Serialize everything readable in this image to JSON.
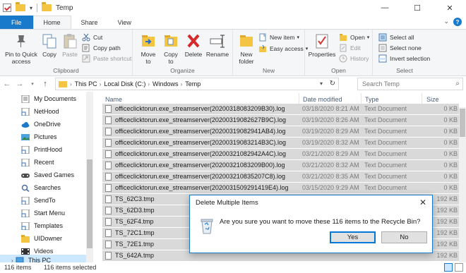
{
  "window": {
    "title": "Temp"
  },
  "tabs": [
    "File",
    "Home",
    "Share",
    "View"
  ],
  "ribbon": {
    "clipboard": {
      "label": "Clipboard",
      "pin": "Pin to Quick access",
      "copy": "Copy",
      "paste": "Paste",
      "cut": "Cut",
      "copy_path": "Copy path",
      "paste_shortcut": "Paste shortcut"
    },
    "organize": {
      "label": "Organize",
      "move_to": "Move to",
      "copy_to": "Copy to",
      "delete": "Delete",
      "rename": "Rename"
    },
    "new": {
      "label": "New",
      "new_folder": "New folder",
      "new_item": "New item",
      "easy_access": "Easy access"
    },
    "open": {
      "label": "Open",
      "properties": "Properties",
      "open": "Open",
      "edit": "Edit",
      "history": "History"
    },
    "select": {
      "label": "Select",
      "select_all": "Select all",
      "select_none": "Select none",
      "invert": "Invert selection"
    }
  },
  "address": {
    "crumbs": [
      "This PC",
      "Local Disk (C:)",
      "Windows",
      "Temp"
    ],
    "search_placeholder": "Search Temp"
  },
  "nav": [
    "My Documents",
    "NetHood",
    "OneDrive",
    "Pictures",
    "PrintHood",
    "Recent",
    "Saved Games",
    "Searches",
    "SendTo",
    "Start Menu",
    "Templates",
    "UIDowner",
    "Videos",
    "This PC"
  ],
  "columns": {
    "name": "Name",
    "date": "Date modified",
    "type": "Type",
    "size": "Size"
  },
  "files": [
    {
      "name": "officeclicktorun.exe_streamserver(20200318083209B30).log",
      "date": "03/18/2020 8:21 AM",
      "type": "Text Document",
      "size": "0 KB"
    },
    {
      "name": "officeclicktorun.exe_streamserver(20200319082627B9C).log",
      "date": "03/19/2020 8:26 AM",
      "type": "Text Document",
      "size": "0 KB"
    },
    {
      "name": "officeclicktorun.exe_streamserver(20200319082941AB4).log",
      "date": "03/19/2020 8:29 AM",
      "type": "Text Document",
      "size": "0 KB"
    },
    {
      "name": "officeclicktorun.exe_streamserver(20200319083214B3C).log",
      "date": "03/19/2020 8:32 AM",
      "type": "Text Document",
      "size": "0 KB"
    },
    {
      "name": "officeclicktorun.exe_streamserver(20200321082942A4C).log",
      "date": "03/21/2020 8:29 AM",
      "type": "Text Document",
      "size": "0 KB"
    },
    {
      "name": "officeclicktorun.exe_streamserver(20200321083209B00).log",
      "date": "03/21/2020 8:32 AM",
      "type": "Text Document",
      "size": "0 KB"
    },
    {
      "name": "officeclicktorun.exe_streamserver(202003210835207C8).log",
      "date": "03/21/2020 8:35 AM",
      "type": "Text Document",
      "size": "0 KB"
    },
    {
      "name": "officeclicktorun.exe_streamserver(2020031509291419E4).log",
      "date": "03/15/2020 9:29 AM",
      "type": "Text Document",
      "size": "0 KB"
    },
    {
      "name": "TS_62C3.tmp",
      "date": "",
      "type": "TMP File",
      "size": "192 KB"
    },
    {
      "name": "TS_62D3.tmp",
      "date": "",
      "type": "",
      "size": "192 KB"
    },
    {
      "name": "TS_62F4.tmp",
      "date": "",
      "type": "",
      "size": "192 KB"
    },
    {
      "name": "TS_72C1.tmp",
      "date": "",
      "type": "",
      "size": "192 KB"
    },
    {
      "name": "TS_72E1.tmp",
      "date": "",
      "type": "",
      "size": "192 KB"
    },
    {
      "name": "TS_642A.tmp",
      "date": "",
      "type": "",
      "size": "192 KB"
    }
  ],
  "status": {
    "count": "116 items",
    "selected": "116 items selected"
  },
  "dialog": {
    "title": "Delete Multiple Items",
    "message": "Are you sure you want to move these 116 items to the Recycle Bin?",
    "yes": "Yes",
    "no": "No"
  },
  "colors": {
    "accent": "#1979ca",
    "selection": "#cce8ff",
    "folder": "#f4c542"
  }
}
